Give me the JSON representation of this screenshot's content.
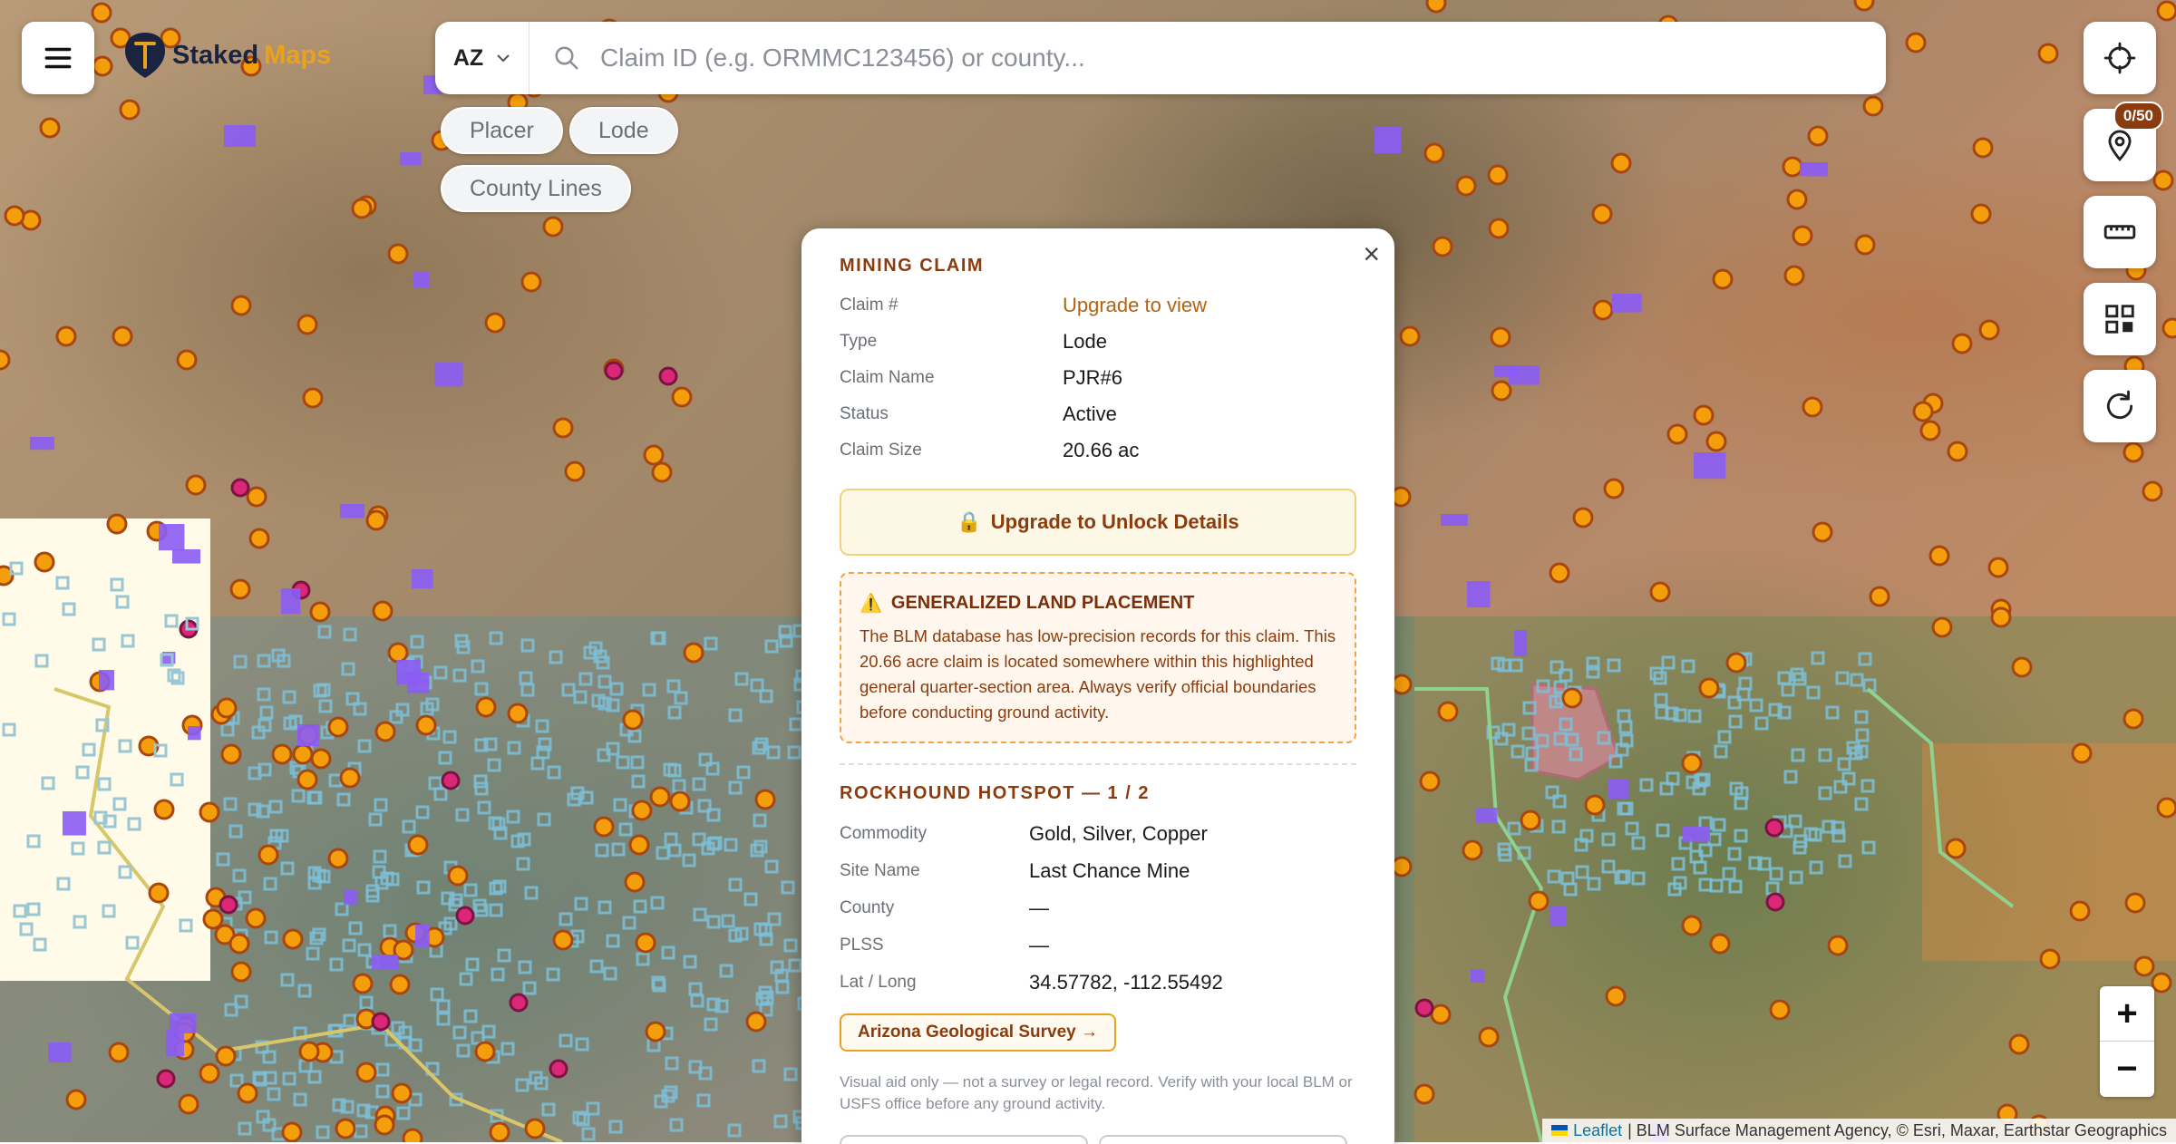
{
  "app": {
    "logo_text_1": "Staked",
    "logo_text_2": "Maps"
  },
  "search": {
    "state": "AZ",
    "placeholder": "Claim ID (e.g. ORMMC123456) or county..."
  },
  "filters": {
    "placer": "Placer",
    "lode": "Lode",
    "county_lines": "County Lines"
  },
  "controls": {
    "pin_count": "0/50"
  },
  "zoom": {
    "in": "+",
    "out": "−"
  },
  "attribution": {
    "leaflet": "Leaflet",
    "rest": "| BLM Surface Management Agency, © Esri, Maxar, Earthstar Geographics"
  },
  "popup": {
    "close": "×",
    "claim_title": "MINING CLAIM",
    "claim_rows": [
      {
        "k": "Claim #",
        "v": "Upgrade to view"
      },
      {
        "k": "Type",
        "v": "Lode"
      },
      {
        "k": "Claim Name",
        "v": "PJR#6"
      },
      {
        "k": "Status",
        "v": "Active"
      },
      {
        "k": "Claim Size",
        "v": "20.66 ac"
      }
    ],
    "unlock_icon": "🔒",
    "unlock_label": "Upgrade to Unlock Details",
    "warn_icon": "⚠️",
    "warn_title": "GENERALIZED LAND PLACEMENT",
    "warn_body": "The BLM database has low-precision records for this claim. This 20.66 acre claim is located somewhere within this highlighted general quarter-section area. Always verify official boundaries before conducting ground activity.",
    "hotspot_title": "ROCKHOUND HOTSPOT — 1 / 2",
    "hotspot_rows": [
      {
        "k": "Commodity",
        "v": "Gold, Silver, Copper"
      },
      {
        "k": "Site Name",
        "v": "Last Chance Mine"
      },
      {
        "k": "County",
        "v": "—"
      },
      {
        "k": "PLSS",
        "v": "—"
      },
      {
        "k": "Lat / Long",
        "v": "34.57782, -112.55492"
      }
    ],
    "geo_button": "Arizona Geological Survey →",
    "disclaimer": "Visual aid only — not a survey or legal record. Verify with your local BLM or USFS office before any ground activity."
  },
  "colors": {
    "accent": "#8a3c0f",
    "gold": "#e8a21f",
    "claim_marker": "#f59e0b",
    "lode_marker": "#8b5cf6",
    "hotspot_marker": "#db2777",
    "blm_grid": "#7cc0d8",
    "county_line": "#8fd18f"
  }
}
